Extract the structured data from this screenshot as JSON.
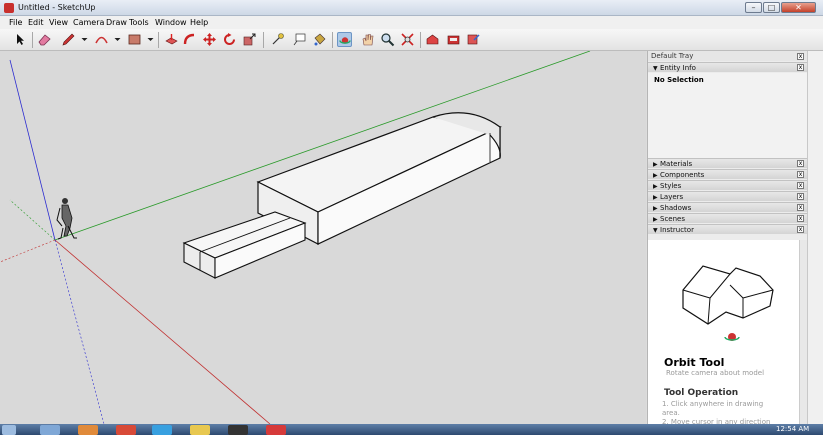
{
  "window": {
    "title": "Untitled - SketchUp",
    "close_label": "✕",
    "min_label": "–",
    "max_label": "□"
  },
  "menu": [
    "File",
    "Edit",
    "View",
    "Camera",
    "Draw",
    "Tools",
    "Window",
    "Help"
  ],
  "toolbar": {
    "tools": [
      "select",
      "eraser",
      "pencil",
      "arc",
      "rectangle",
      "push-pull",
      "follow-me",
      "move",
      "rotate",
      "scale",
      "tape-measure",
      "text",
      "paint-bucket",
      "orbit",
      "pan",
      "zoom",
      "zoom-extents",
      "component-1",
      "component-2",
      "component-3"
    ]
  },
  "tray": {
    "title": "Default Tray",
    "entity_info": {
      "label": "Entity Info",
      "selection": "No Selection"
    },
    "panels": [
      "Materials",
      "Components",
      "Styles",
      "Layers",
      "Shadows",
      "Scenes",
      "Instructor"
    ],
    "instructor": {
      "title": "Orbit Tool",
      "subtitle": "Rotate camera about model",
      "operation_heading": "Tool Operation",
      "steps": [
        "1.  Click anywhere in drawing",
        "     area.",
        "2.  Move cursor in any direction"
      ]
    }
  },
  "taskbar": {
    "clock": "12:54 AM"
  },
  "colors": {
    "red_axis": "#c03030",
    "green_axis": "#2a9a2a",
    "blue_axis": "#2a2ad0",
    "model_face": "#f4f4f4"
  },
  "icons": [
    "app-icon",
    "start-orb-icon",
    "explorer-icon",
    "media-icon",
    "chrome-icon",
    "skype-icon",
    "folder-icon",
    "terminal-icon",
    "sketchup-taskbar-icon"
  ]
}
